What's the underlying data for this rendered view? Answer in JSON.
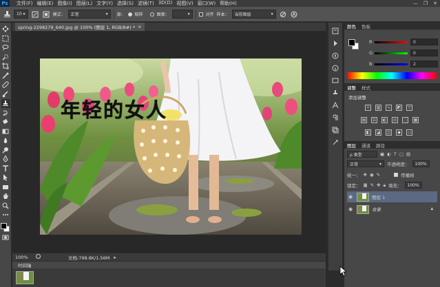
{
  "app": {
    "logo": "Ps"
  },
  "menu": [
    "文件(F)",
    "编辑(E)",
    "图像(I)",
    "图层(L)",
    "文字(Y)",
    "选择(S)",
    "滤镜(T)",
    "3D(D)",
    "视图(V)",
    "窗口(W)",
    "帮助(H)"
  ],
  "window_controls": {
    "minimize": "—",
    "restore": "❐",
    "close": "✕"
  },
  "options": {
    "brush_size": "10",
    "mode_label": "模式：",
    "mode_value": "正常",
    "source_label": "源：",
    "sampled_label": "取样",
    "pattern_label": "图案：",
    "aligned_label": "对齐",
    "sample_label": "样本：",
    "sample_value": "当前图层"
  },
  "document": {
    "tab_title": "spring-2298279_640.jpg @ 100% (图层 1, RGB/8#) *",
    "tab_close": "×",
    "canvas_text": "年轻的女人"
  },
  "status": {
    "zoom": "100%",
    "doc": "文档:798.8K/1.56M"
  },
  "timeline": {
    "tab": "时间轴"
  },
  "color_panel": {
    "tabs": [
      "颜色",
      "色板"
    ],
    "r_label": "R",
    "r_value": "0",
    "g_label": "G",
    "g_value": "0",
    "b_label": "B",
    "b_value": "2"
  },
  "adjust_panel": {
    "tabs": [
      "调整",
      "样式"
    ],
    "title": "添加调整"
  },
  "layers_panel": {
    "tabs": [
      "图层",
      "通道",
      "路径"
    ],
    "kind_value": "ρ 类型",
    "blend_value": "正常",
    "opacity_label": "不透明度：",
    "opacity_value": "100%",
    "unify_label": "统一：",
    "propagate_label": "传播帧",
    "lock_label": "锁定：",
    "fill_label": "填充：",
    "fill_value": "100%",
    "layers": [
      {
        "name": "图层 1",
        "selected": true
      },
      {
        "name": "背景",
        "selected": false
      }
    ]
  },
  "colors": {
    "accent_selected_layer": "#5b6a82",
    "chrome_dark": "#282828",
    "panel": "#474747"
  }
}
